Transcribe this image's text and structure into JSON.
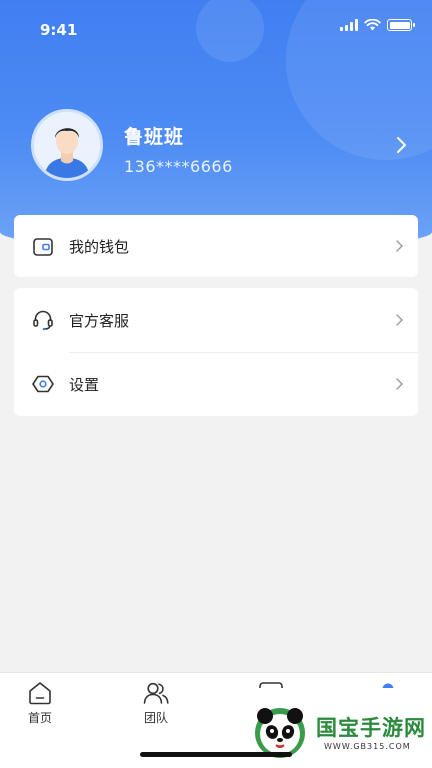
{
  "status_bar": {
    "time": "9:41"
  },
  "profile": {
    "name": "鲁班班",
    "phone": "136****6666"
  },
  "menu": {
    "wallet": {
      "label": "我的钱包",
      "icon": "wallet-icon"
    },
    "service": {
      "label": "官方客服",
      "icon": "headset-icon"
    },
    "settings": {
      "label": "设置",
      "icon": "settings-hexagon-icon"
    }
  },
  "tabbar": {
    "tabs": [
      {
        "label": "首页",
        "icon": "home-icon"
      },
      {
        "label": "团队",
        "icon": "team-icon"
      },
      {
        "label": "",
        "icon": "message-icon"
      },
      {
        "label": "",
        "icon": "profile-dot-icon"
      }
    ]
  },
  "watermark": {
    "title": "国宝手游网",
    "url": "WWW.GB315.COM"
  },
  "colors": {
    "primary": "#4283f3",
    "background": "#f2f2f2",
    "card": "#ffffff"
  }
}
